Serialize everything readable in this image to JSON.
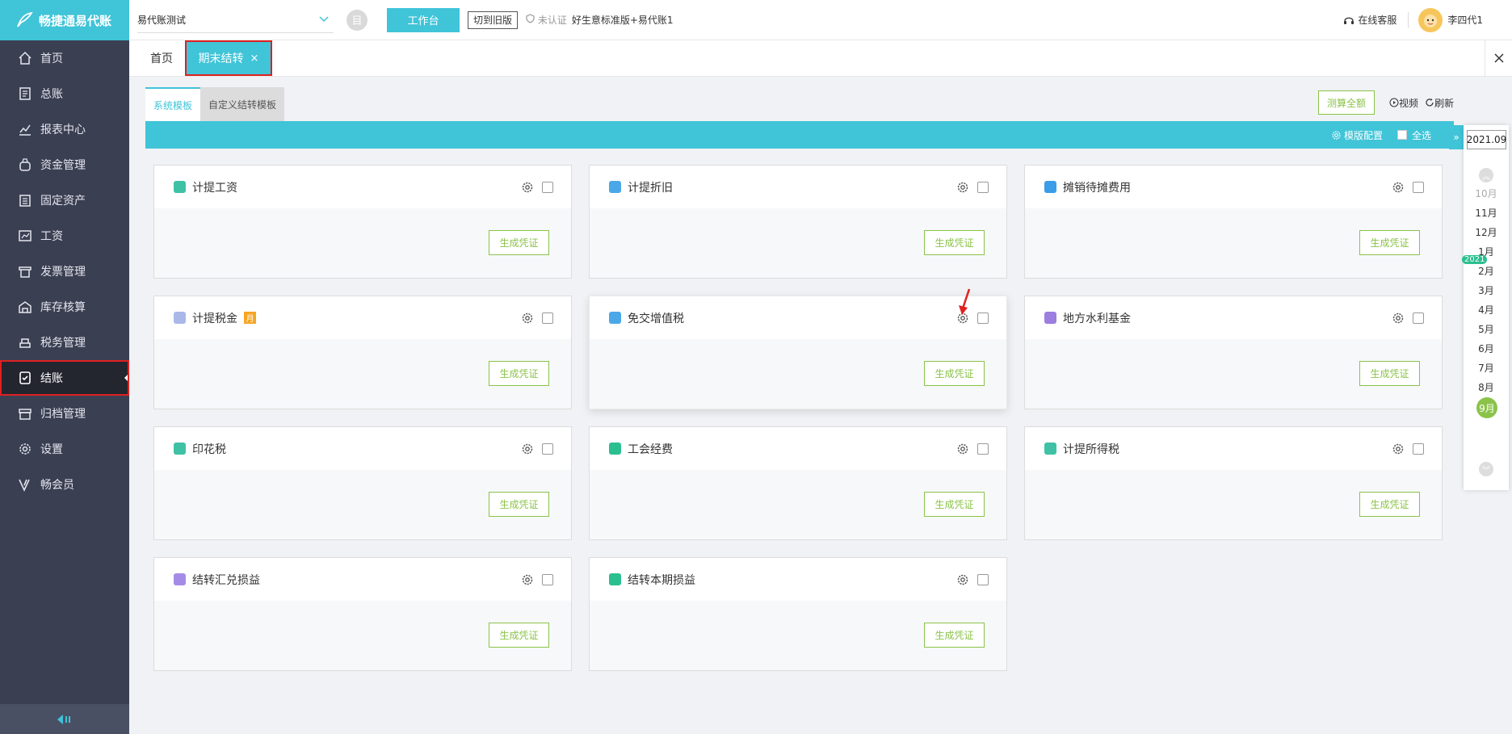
{
  "app": {
    "name": "畅捷通易代账",
    "brand_color": "#40c4d8"
  },
  "sidebar": {
    "items": [
      {
        "label": "首页",
        "icon": "home-icon"
      },
      {
        "label": "总账",
        "icon": "ledger-icon"
      },
      {
        "label": "报表中心",
        "icon": "report-icon"
      },
      {
        "label": "资金管理",
        "icon": "fund-icon"
      },
      {
        "label": "固定资产",
        "icon": "asset-icon"
      },
      {
        "label": "工资",
        "icon": "salary-icon"
      },
      {
        "label": "发票管理",
        "icon": "invoice-icon"
      },
      {
        "label": "库存核算",
        "icon": "inventory-icon"
      },
      {
        "label": "税务管理",
        "icon": "tax-icon"
      },
      {
        "label": "结账",
        "icon": "closing-icon",
        "active": true
      },
      {
        "label": "归档管理",
        "icon": "archive-icon"
      },
      {
        "label": "设置",
        "icon": "settings-icon"
      },
      {
        "label": "畅会员",
        "icon": "member-icon"
      }
    ]
  },
  "topbar": {
    "account": "易代账测试",
    "account_icon_text": "目",
    "workbench": "工作台",
    "old_version": "切到旧版",
    "certify": "未认证",
    "edition": "好生意标准版+易代账1",
    "service": "在线客服",
    "user": "李四代1"
  },
  "tabs": {
    "home": "首页",
    "active": "期末结转",
    "close": "×"
  },
  "content": {
    "subtabs": {
      "system": "系统模板",
      "custom": "自定义结转模板"
    },
    "actions": {
      "measure_all": "测算全额",
      "video": "视频",
      "refresh": "刷新"
    },
    "bar": {
      "template_config": "模版配置",
      "select_all": "全选"
    },
    "generate_label": "生成凭证",
    "cards": [
      {
        "title": "计提工资",
        "icon_color": "#3fc1a5"
      },
      {
        "title": "计提折旧",
        "icon_color": "#4aa8e8"
      },
      {
        "title": "摊销待摊费用",
        "icon_color": "#3b9ce8"
      },
      {
        "title": "计提税金",
        "icon_color": "#a9b8e8",
        "badge": "月"
      },
      {
        "title": "免交增值税",
        "icon_color": "#4aa8e8"
      },
      {
        "title": "地方水利基金",
        "icon_color": "#9b7ee0"
      },
      {
        "title": "印花税",
        "icon_color": "#3fc1a5"
      },
      {
        "title": "工会经费",
        "icon_color": "#2bbf8f"
      },
      {
        "title": "计提所得税",
        "icon_color": "#3fc1a5"
      },
      {
        "title": "结转汇兑损益",
        "icon_color": "#a58be8"
      },
      {
        "title": "结转本期损益",
        "icon_color": "#2bbf8f"
      }
    ]
  },
  "period_picker": {
    "value": "2021.09",
    "year_flag": "2021",
    "months": [
      "10月",
      "11月",
      "12月",
      "1月",
      "2月",
      "3月",
      "4月",
      "5月",
      "6月",
      "7月",
      "8月",
      "9月"
    ],
    "selected": "9月"
  }
}
